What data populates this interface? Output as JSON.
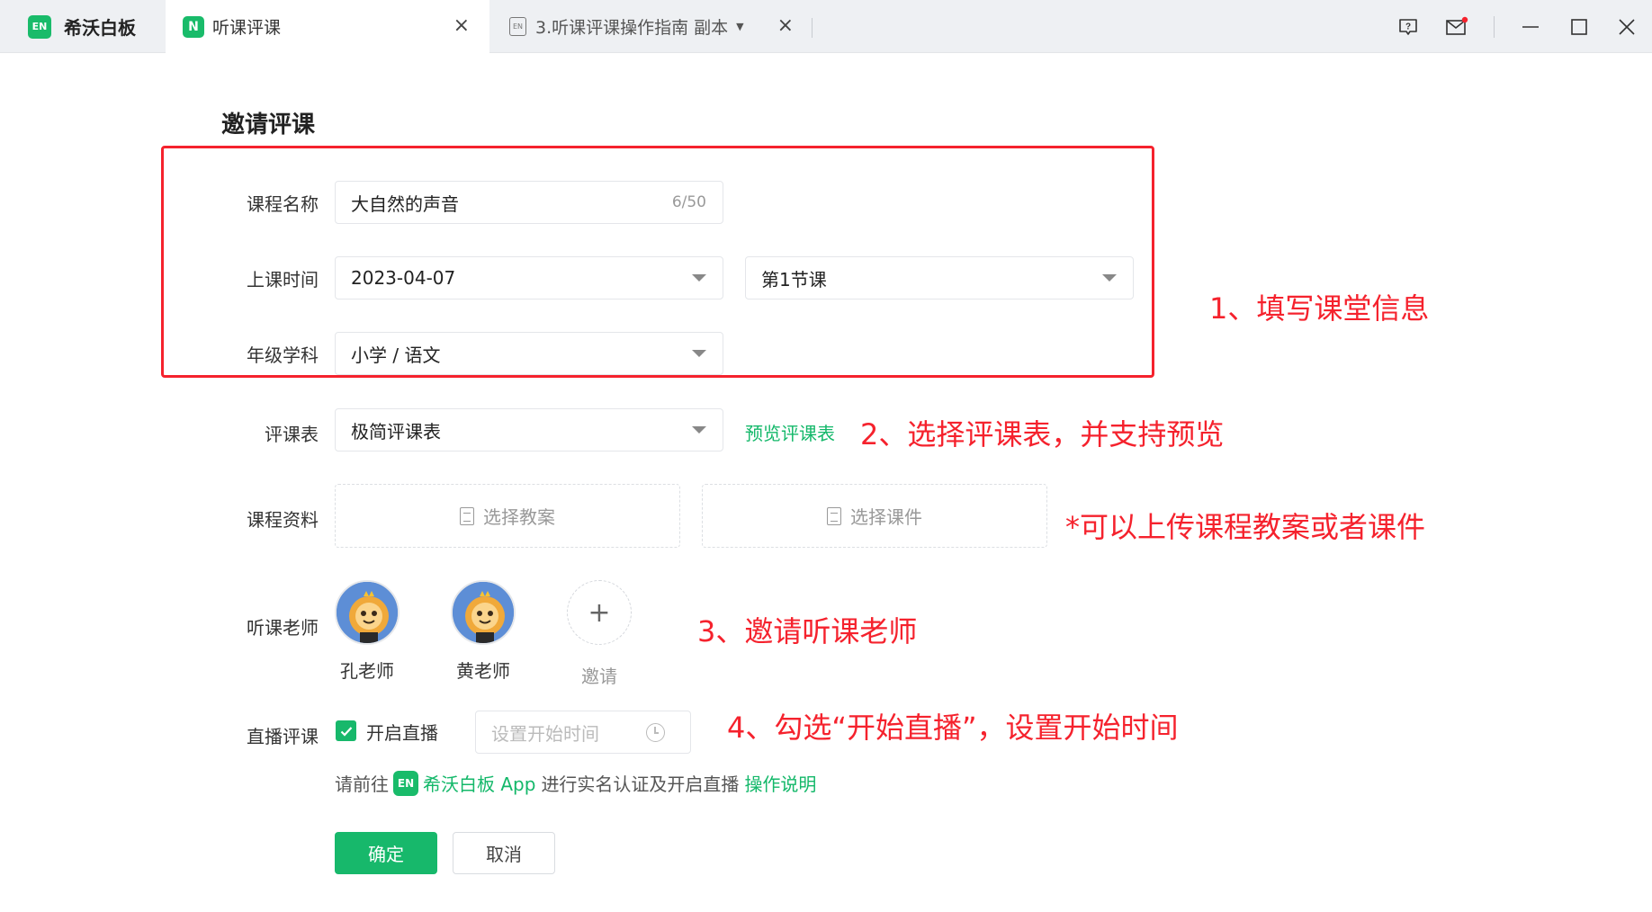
{
  "tabs": {
    "home": {
      "label": "希沃白板",
      "logo_text": "EN"
    },
    "active": {
      "label": "听课评课",
      "logo_text": "N"
    },
    "doc": {
      "label": "3.听课评课操作指南 副本",
      "icon_text": "EN"
    }
  },
  "form": {
    "title": "邀请评课",
    "course_name": {
      "label": "课程名称",
      "value": "大自然的声音",
      "count": "6/50"
    },
    "class_time": {
      "label": "上课时间",
      "date": "2023-04-07",
      "period": "第1节课"
    },
    "grade_subject": {
      "label": "年级学科",
      "value": "小学 / 语文"
    },
    "rating_form": {
      "label": "评课表",
      "value": "极简评课表",
      "preview_link": "预览评课表"
    },
    "materials": {
      "label": "课程资料",
      "lesson_plan_button": "选择教案",
      "courseware_button": "选择课件"
    },
    "teachers": {
      "label": "听课老师",
      "list": [
        {
          "name": "孔老师"
        },
        {
          "name": "黄老师"
        }
      ],
      "invite_label": "邀请"
    },
    "live": {
      "label": "直播评课",
      "checkbox_label": "开启直播",
      "checked": true,
      "time_placeholder": "设置开始时间"
    },
    "hint": {
      "prefix": "请前往",
      "logo_text": "EN",
      "app_name": "希沃白板 App",
      "middle": "进行实名认证及开启直播",
      "link": "操作说明"
    },
    "confirm_button": "确定",
    "cancel_button": "取消"
  },
  "annotations": {
    "step1": "1、填写课堂信息",
    "step2": "2、选择评课表，并支持预览",
    "note": "*可以上传课程教案或者课件",
    "step3": "3、邀请听课老师",
    "step4": "4、勾选“开始直播”，设置开始时间"
  },
  "colors": {
    "accent": "#17b86b",
    "annotation": "#f5222d"
  }
}
